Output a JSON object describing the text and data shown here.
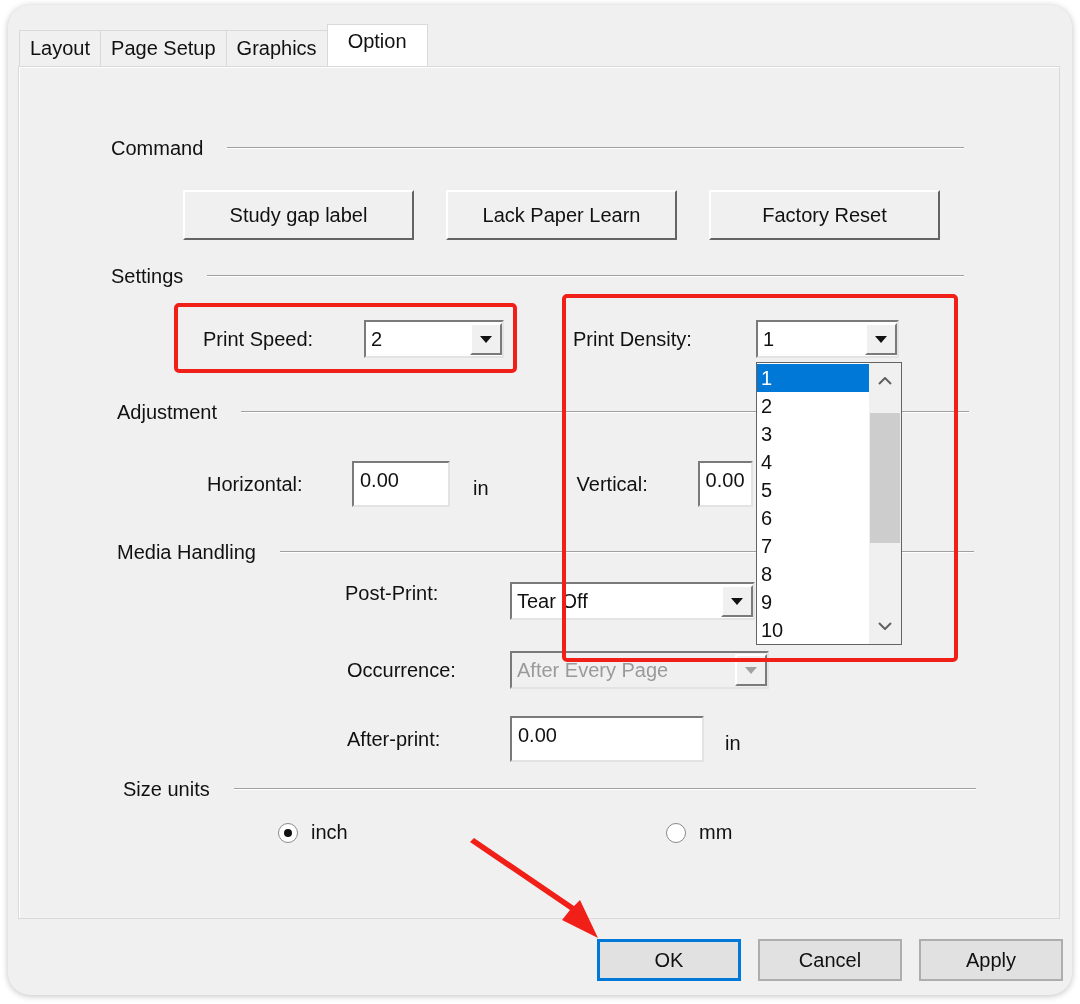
{
  "tabs": [
    {
      "label": "Layout",
      "selected": false
    },
    {
      "label": "Page Setup",
      "selected": false
    },
    {
      "label": "Graphics",
      "selected": false
    },
    {
      "label": "Option",
      "selected": true
    }
  ],
  "command": {
    "heading": "Command",
    "buttons": [
      "Study gap label",
      "Lack Paper Learn",
      "Factory Reset"
    ]
  },
  "settings": {
    "heading": "Settings",
    "print_speed": {
      "label": "Print Speed:",
      "value": "2"
    },
    "print_density": {
      "label": "Print Density:",
      "value": "1",
      "expanded": true,
      "options": [
        {
          "label": "1",
          "selected": true
        },
        {
          "label": "2",
          "selected": false
        },
        {
          "label": "3",
          "selected": false
        },
        {
          "label": "4",
          "selected": false
        },
        {
          "label": "5",
          "selected": false
        },
        {
          "label": "6",
          "selected": false
        },
        {
          "label": "7",
          "selected": false
        },
        {
          "label": "8",
          "selected": false
        },
        {
          "label": "9",
          "selected": false
        },
        {
          "label": "10",
          "selected": false
        }
      ]
    }
  },
  "adjustment": {
    "heading": "Adjustment",
    "horizontal": {
      "label": "Horizontal:",
      "value": "0.00",
      "unit": "in"
    },
    "vertical": {
      "label": "Vertical:",
      "value": "0.00"
    }
  },
  "media_handling": {
    "heading": "Media Handling",
    "post_print": {
      "label": "Post-Print:",
      "value": "Tear Off"
    },
    "occurrence": {
      "label": "Occurrence:",
      "value": "After Every Page",
      "disabled": true
    },
    "after_print": {
      "label": "After-print:",
      "value": "0.00",
      "unit": "in"
    }
  },
  "size_units": {
    "heading": "Size units",
    "options": [
      {
        "label": "inch",
        "selected": true
      },
      {
        "label": "mm",
        "selected": false
      }
    ]
  },
  "buttons": [
    {
      "label": "OK",
      "focused": true
    },
    {
      "label": "Cancel",
      "focused": false
    },
    {
      "label": "Apply",
      "focused": false
    }
  ]
}
